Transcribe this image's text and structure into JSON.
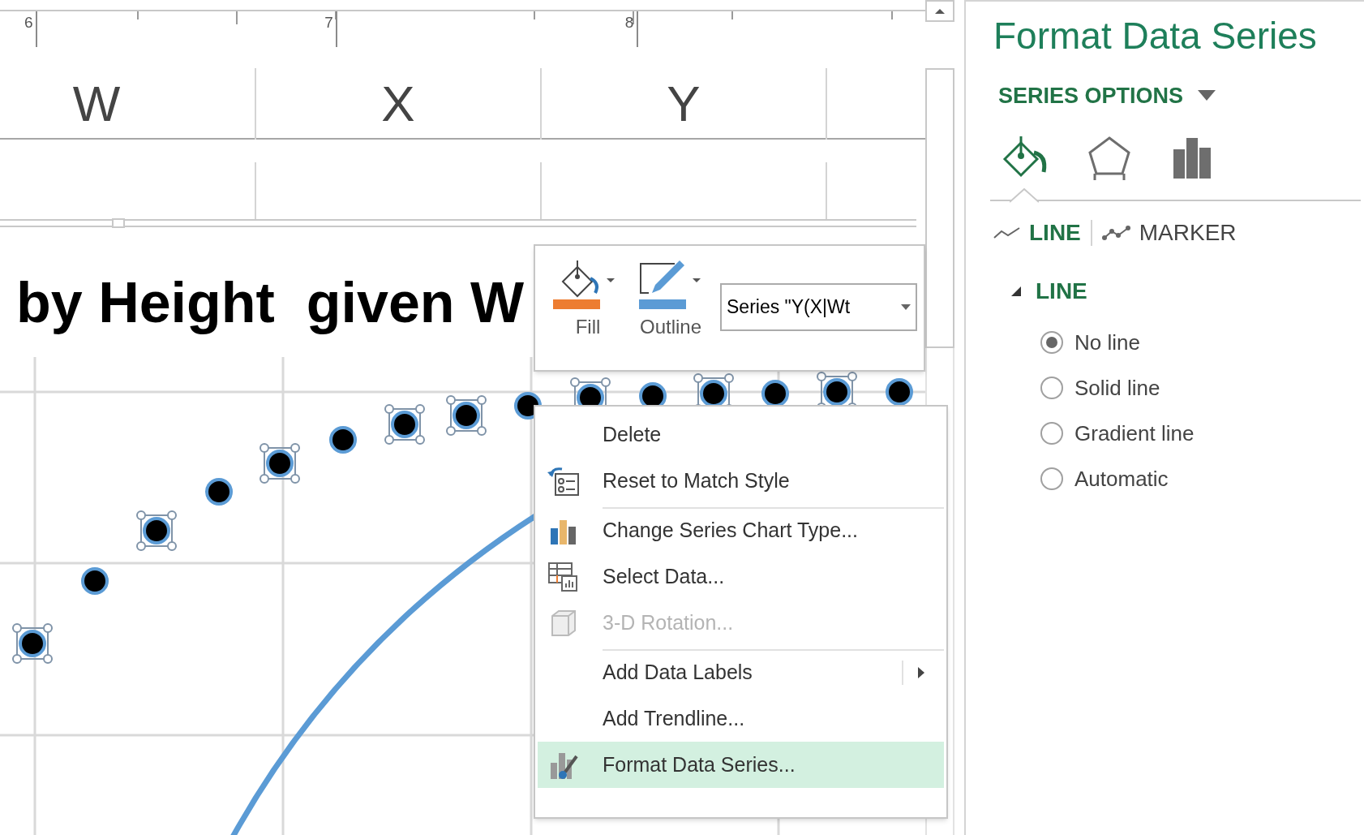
{
  "ruler": {
    "marks": [
      "6",
      "7",
      "8"
    ]
  },
  "sheet": {
    "columns": [
      "W",
      "X",
      "Y"
    ]
  },
  "chart": {
    "title": "by Height  given W"
  },
  "mini_toolbar": {
    "buttons": [
      {
        "label": "Fill"
      },
      {
        "label": "Outline"
      }
    ],
    "series_dropdown": {
      "value": "Series \"Y(X|Wt"
    }
  },
  "context_menu": {
    "items": [
      {
        "label": "Delete",
        "disabled": false,
        "selected": false,
        "submenu": false,
        "separator_before": false
      },
      {
        "label": "Reset to Match Style",
        "disabled": false,
        "selected": false,
        "submenu": false,
        "separator_before": false
      },
      {
        "label": "Change Series Chart Type...",
        "disabled": false,
        "selected": false,
        "submenu": false,
        "separator_before": true
      },
      {
        "label": "Select Data...",
        "disabled": false,
        "selected": false,
        "submenu": false,
        "separator_before": false
      },
      {
        "label": "3-D Rotation...",
        "disabled": true,
        "selected": false,
        "submenu": false,
        "separator_before": false
      },
      {
        "label": "Add Data Labels",
        "disabled": false,
        "selected": false,
        "submenu": true,
        "separator_before": true
      },
      {
        "label": "Add Trendline...",
        "disabled": false,
        "selected": false,
        "submenu": false,
        "separator_before": false
      },
      {
        "label": "Format Data Series...",
        "disabled": false,
        "selected": true,
        "submenu": false,
        "separator_before": false
      }
    ]
  },
  "format_pane": {
    "title": "Format Data Series",
    "options_menu": "SERIES OPTIONS",
    "category_tabs": [
      {
        "selected": true
      },
      {
        "selected": false
      },
      {
        "selected": false
      }
    ],
    "sub_tabs": [
      {
        "label": "LINE",
        "selected": true
      },
      {
        "label": "MARKER",
        "selected": false
      }
    ],
    "section": {
      "label": "LINE",
      "expanded": true
    },
    "line_options": [
      {
        "label": "No line",
        "selected": true
      },
      {
        "label": "Solid line",
        "selected": false
      },
      {
        "label": "Gradient line",
        "selected": false
      },
      {
        "label": "Automatic",
        "selected": false
      }
    ]
  }
}
